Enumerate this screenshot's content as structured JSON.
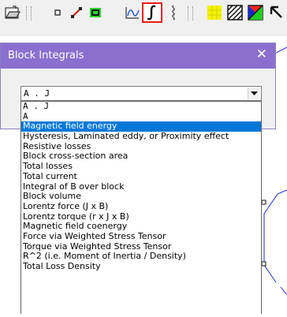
{
  "toolbar": {
    "buttons": [
      {
        "icon": "open-folder-icon"
      },
      {
        "icon": "node-mode-icon"
      },
      {
        "icon": "segment-mode-icon"
      },
      {
        "icon": "block-label-mode-icon"
      },
      {
        "icon": "plot-line-icon"
      },
      {
        "icon": "integral-icon",
        "active": true
      },
      {
        "icon": "coil-icon"
      },
      {
        "icon": "contour-grid-icon"
      },
      {
        "icon": "hatched-grid-icon"
      },
      {
        "icon": "density-plot-icon"
      },
      {
        "icon": "arrow-pointer-icon"
      }
    ],
    "accent": "#e81c1c"
  },
  "dialog": {
    "title": "Block Integrals",
    "close_glyph": "✕",
    "title_color": "#8b6fcf",
    "combo": {
      "value": "A . J"
    },
    "options": [
      "A . J",
      "A",
      "Magnetic field energy",
      "Hysteresis, Laminated eddy, or Proximity effect",
      "Resistive losses",
      "Block cross-section area",
      "Total losses",
      "Total current",
      "Integral of B over block",
      "Block volume",
      "Lorentz force (J x B)",
      "Lorentz torque (r x J x B)",
      "Magnetic field coenergy",
      "Force via Weighted Stress Tensor",
      "Torque via Weighted Stress Tensor",
      "R^2 (i.e. Moment of Inertia / Density)",
      "Total Loss Density"
    ],
    "selected_index": 2,
    "selection_color": "#0078d7"
  }
}
